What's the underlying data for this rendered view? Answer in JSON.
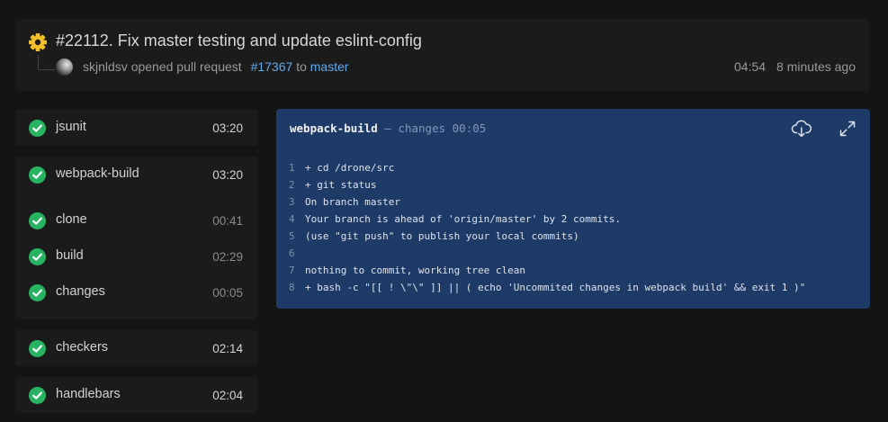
{
  "build": {
    "status_icon": "gear-icon",
    "title": "#22112. Fix master testing and update eslint-config",
    "author": "skjnldsv",
    "action": "opened pull request",
    "pr_link": "#17367",
    "to": "to",
    "branch": "master",
    "duration": "04:54",
    "time_ago": "8 minutes ago"
  },
  "pipeline": {
    "stages": [
      {
        "name": "jsunit",
        "duration": "03:20",
        "status": "success",
        "steps": []
      },
      {
        "name": "webpack-build",
        "duration": "03:20",
        "status": "success",
        "steps": [
          {
            "name": "clone",
            "duration": "00:41",
            "status": "success"
          },
          {
            "name": "build",
            "duration": "02:29",
            "status": "success"
          },
          {
            "name": "changes",
            "duration": "00:05",
            "status": "success"
          }
        ]
      },
      {
        "name": "checkers",
        "duration": "02:14",
        "status": "success",
        "steps": []
      },
      {
        "name": "handlebars",
        "duration": "02:04",
        "status": "success",
        "steps": []
      }
    ]
  },
  "log": {
    "job": "webpack-build",
    "separator": "—",
    "step": "changes",
    "duration": "00:05",
    "download_icon": "cloud-download-icon",
    "expand_icon": "expand-icon",
    "lines": [
      {
        "n": "1",
        "text": "+ cd /drone/src"
      },
      {
        "n": "2",
        "text": "+ git status"
      },
      {
        "n": "3",
        "text": "On branch master"
      },
      {
        "n": "4",
        "text": "Your branch is ahead of 'origin/master' by 2 commits."
      },
      {
        "n": "5",
        "text": "(use \"git push\" to publish your local commits)"
      },
      {
        "n": "6",
        "text": ""
      },
      {
        "n": "7",
        "text": "nothing to commit, working tree clean"
      },
      {
        "n": "8",
        "text": "+ bash -c \"[[ ! \\\"\\\" ]] || ( echo 'Uncommited changes in webpack build' && exit 1 )\""
      }
    ]
  },
  "colors": {
    "success": "#27b362",
    "link": "#5fa9ee",
    "log_bg": "#1e3a66",
    "status_running": "#f4c02a"
  }
}
